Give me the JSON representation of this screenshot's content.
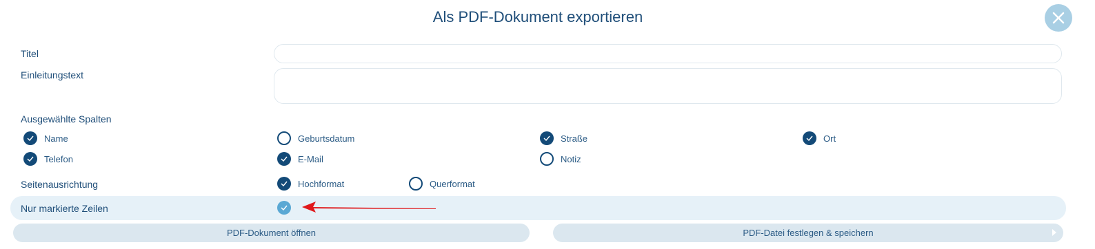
{
  "dialog": {
    "title": "Als PDF-Dokument exportieren"
  },
  "form": {
    "titel_label": "Titel",
    "titel_value": "",
    "einleitung_label": "Einleitungstext",
    "einleitung_value": "",
    "columns_label": "Ausgewählte Spalten",
    "columns": [
      {
        "label": "Name",
        "checked": true
      },
      {
        "label": "Geburtsdatum",
        "checked": false
      },
      {
        "label": "Straße",
        "checked": true
      },
      {
        "label": "Ort",
        "checked": true
      },
      {
        "label": "Telefon",
        "checked": true
      },
      {
        "label": "E-Mail",
        "checked": true
      },
      {
        "label": "Notiz",
        "checked": false
      }
    ],
    "orientation_label": "Seitenausrichtung",
    "orientation_options": [
      {
        "label": "Hochformat",
        "checked": true
      },
      {
        "label": "Querformat",
        "checked": false
      }
    ],
    "marked_rows_label": "Nur markierte Zeilen",
    "marked_rows_checked": true
  },
  "buttons": {
    "open_pdf": "PDF-Dokument öffnen",
    "save_pdf": "PDF-Datei festlegen & speichern"
  },
  "colors": {
    "primary": "#134a78",
    "text": "#1f4e79",
    "highlight_row": "#e6f1f8",
    "button_bg": "#dbe7ef",
    "close_bg": "#a9cfe4",
    "arrow": "#e0181b"
  },
  "icons": {
    "close": "close-icon",
    "check": "check-icon",
    "arrow": "arrow-annotation"
  }
}
